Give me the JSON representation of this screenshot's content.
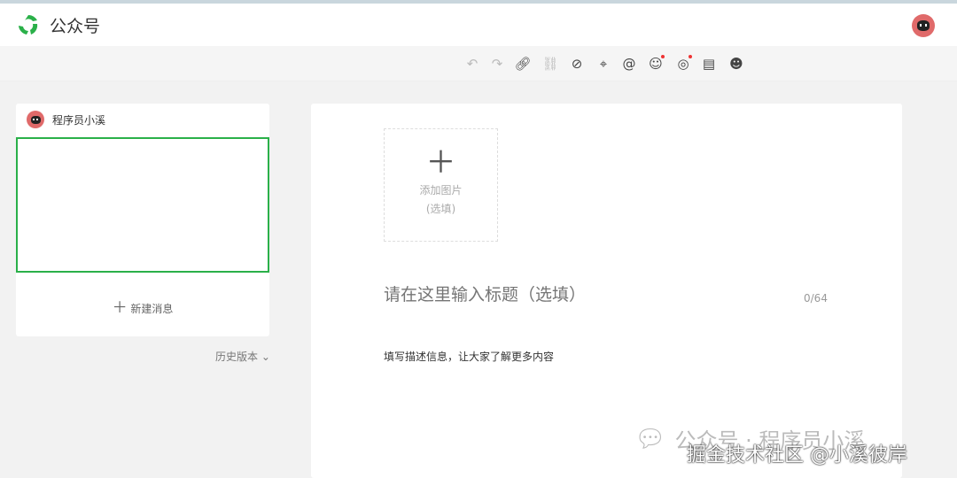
{
  "header": {
    "brand": "公众号",
    "accent": "#2ab049"
  },
  "toolbar": {
    "icons": [
      "undo-icon",
      "redo-icon",
      "link-icon",
      "unlink-icon",
      "mini-program-icon",
      "location-icon",
      "mention-icon",
      "avatar-card-icon",
      "circle-icon",
      "inbox-icon",
      "emoji-icon"
    ]
  },
  "sidebar": {
    "account_name": "程序员小溪",
    "new_message": "新建消息",
    "history": "历史版本"
  },
  "editor": {
    "add_image": "添加图片",
    "add_image_note": "(选填)",
    "title_placeholder": "请在这里输入标题（选填）",
    "title_counter": "0/64",
    "description_placeholder": "填写描述信息，让大家了解更多内容"
  },
  "watermark": {
    "line1": "公众号 · 程序员小溪",
    "line2": "掘金技术社区 @小溪彼岸"
  }
}
